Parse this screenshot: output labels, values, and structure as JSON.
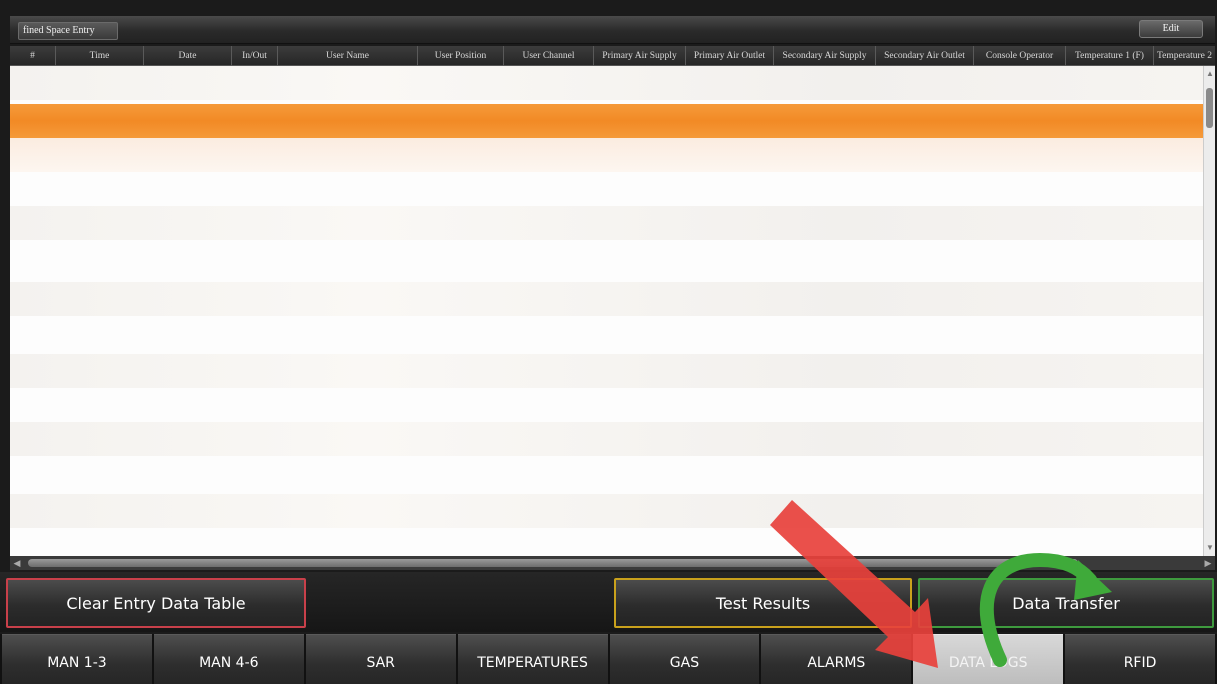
{
  "window": {
    "tab_title": "fined Space Entry",
    "edit_label": "Edit"
  },
  "table": {
    "columns": [
      "#",
      "Time",
      "Date",
      "In/Out",
      "User Name",
      "User Position",
      "User Channel",
      "Primary Air Supply",
      "Primary Air Outlet",
      "Secondary Air Supply",
      "Secondary Air Outlet",
      "Console Operator",
      "Temperature 1 (F)",
      "Temperature 2"
    ],
    "rows": []
  },
  "actions": {
    "clear_label": "Clear Entry Data Table",
    "test_label": "Test Results",
    "transfer_label": "Data Transfer"
  },
  "nav": {
    "tabs": [
      "MAN 1-3",
      "MAN 4-6",
      "SAR",
      "TEMPERATURES",
      "GAS",
      "ALARMS",
      "DATA LOGS",
      "RFID"
    ],
    "active": "DATA LOGS"
  },
  "colors": {
    "selected_row": "#f28a25",
    "clear_border": "#c8404a",
    "test_border": "#c9a11c",
    "transfer_border": "#3e9a3e",
    "annotation_red_arrow": "#e8413c",
    "annotation_green_arrow": "#3faa3a"
  },
  "icons": {
    "red_arrow": "pointer-arrow-icon",
    "green_arrow": "curved-arrow-icon"
  }
}
